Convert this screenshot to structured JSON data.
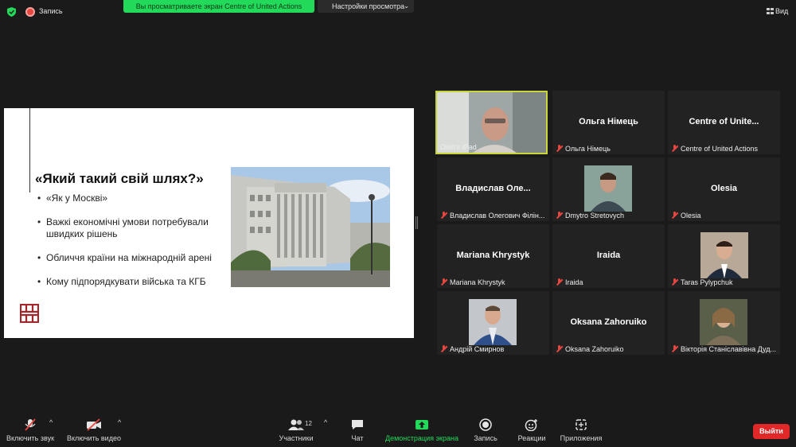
{
  "topbar": {
    "recording_label": "Запись",
    "share_banner": "Вы просматриваете экран Centre of United Actions",
    "view_settings": "Настройки просмотра",
    "view_label": "Вид"
  },
  "slide": {
    "title": "«Який такий свій шлях?»",
    "bullets": [
      "«Як у Москві»",
      "Важкі економічні умови потребували швидких рішень",
      "Обличчя країни на міжнародній арені",
      "Кому підпорядкувати війська та КГБ"
    ]
  },
  "participants": [
    {
      "label": "Oleh's iPad",
      "center_name": "",
      "muted": false,
      "video": true
    },
    {
      "label": "Ольга Німець",
      "center_name": "Ольга Німець",
      "muted": true,
      "video": false
    },
    {
      "label": "Centre of United Actions",
      "center_name": "Centre of Unite...",
      "muted": true,
      "video": false
    },
    {
      "label": "Владислав Олегович Філін...",
      "center_name": "Владислав Оле...",
      "muted": true,
      "video": false
    },
    {
      "label": "Dmytro Stretovych",
      "center_name": "",
      "muted": true,
      "video": true
    },
    {
      "label": "Olesia",
      "center_name": "Olesia",
      "muted": true,
      "video": false
    },
    {
      "label": "Mariana Khrystyk",
      "center_name": "Mariana Khrystyk",
      "muted": true,
      "video": false
    },
    {
      "label": "Iraida",
      "center_name": "Iraida",
      "muted": true,
      "video": false
    },
    {
      "label": "Taras Pylypchuk",
      "center_name": "",
      "muted": true,
      "video": true
    },
    {
      "label": "Андрій Смирнов",
      "center_name": "",
      "muted": true,
      "video": true
    },
    {
      "label": "Oksana Zahoruiko",
      "center_name": "Oksana Zahoruiko",
      "muted": true,
      "video": false
    },
    {
      "label": "Вікторія Станіславівна Дуд...",
      "center_name": "",
      "muted": true,
      "video": true
    }
  ],
  "toolbar": {
    "unmute": "Включить звук",
    "start_video": "Включить видео",
    "participants": "Участники",
    "participants_count": "12",
    "chat": "Чат",
    "share_screen": "Демонстрация экрана",
    "record": "Запись",
    "reactions": "Реакции",
    "apps": "Приложения",
    "leave": "Выйти"
  },
  "colors": {
    "share_green": "#23d959",
    "active_speaker": "#c9d63a",
    "leave_red": "#e02828",
    "muted_red": "#e8473f"
  }
}
